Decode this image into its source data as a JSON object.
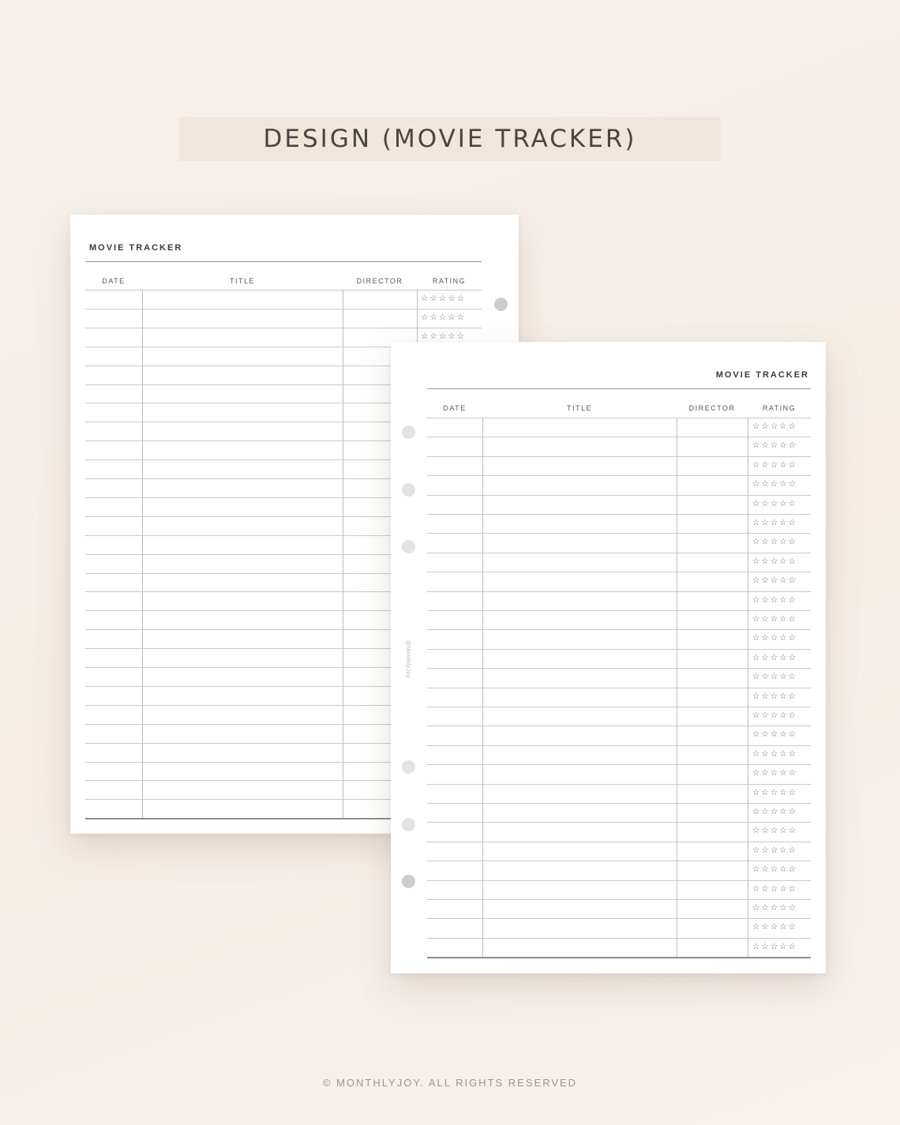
{
  "banner": {
    "title": "DESIGN (MOVIE TRACKER)"
  },
  "sheet_title": "MOVIE TRACKER",
  "columns": {
    "date": "DATE",
    "title": "TITLE",
    "director": "DIRECTOR",
    "rating": "RATING"
  },
  "rating_stars": "☆☆☆☆☆",
  "watermark": "@MonthlyJoy",
  "back_sheet": {
    "row_count": 28,
    "visible_rating_rows": 3
  },
  "front_sheet": {
    "row_count": 28
  },
  "footer": "© MONTHLYJOY. ALL RIGHTS RESERVED"
}
